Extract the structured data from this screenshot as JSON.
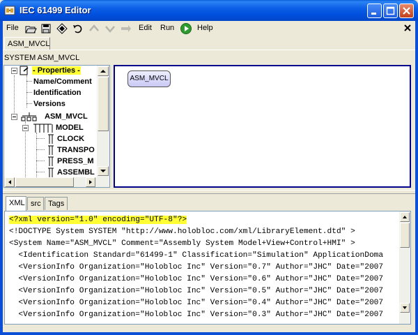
{
  "window": {
    "title": "IEC 61499 Editor"
  },
  "menu": {
    "file": "File",
    "edit": "Edit",
    "run": "Run",
    "help": "Help"
  },
  "toolbar": {
    "icons": [
      "open-folder-icon",
      "save-icon",
      "save-all-icon",
      "undo-icon",
      "up-arrow-icon",
      "down-arrow-icon",
      "right-arrow-icon",
      "run-icon"
    ]
  },
  "doc_tab": "ASM_MVCL",
  "system_label": "SYSTEM ASM_MVCL",
  "tree": {
    "properties": "- Properties -",
    "name_comment": "Name/Comment",
    "identification": "Identification",
    "versions": "Versions",
    "system": "ASM_MVCL",
    "model": "MODEL",
    "clock": "CLOCK",
    "transport": "TRANSPO",
    "press": "PRESS_M",
    "assembly": "ASSEMBL"
  },
  "diagram": {
    "block_label": "ASM_MVCL"
  },
  "bottom_tabs": [
    "XML",
    "src",
    "Tags"
  ],
  "xml": {
    "lines": [
      "<?xml version=\"1.0\" encoding=\"UTF-8\"?>",
      "<!DOCTYPE System SYSTEM \"http://www.holobloc.com/xml/LibraryElement.dtd\" >",
      "<System Name=\"ASM_MVCL\" Comment=\"Assembly System Model+View+Control+HMI\" >",
      "  <Identification Standard=\"61499-1\" Classification=\"Simulation\" ApplicationDoma",
      "  <VersionInfo Organization=\"Holobloc Inc\" Version=\"0.7\" Author=\"JHC\" Date=\"2007",
      "  <VersionInfo Organization=\"Holobloc Inc\" Version=\"0.6\" Author=\"JHC\" Date=\"2007",
      "  <VersionInfo Organization=\"Holobloc Inc\" Version=\"0.5\" Author=\"JHC\" Date=\"2007",
      "  <VersionInfo Organization=\"Holobloc Inc\" Version=\"0.4\" Author=\"JHC\" Date=\"2007",
      "  <VersionInfo Organization=\"Holobloc Inc\" Version=\"0.3\" Author=\"JHC\" Date=\"2007"
    ]
  },
  "colors": {
    "titlebar": "#0050de",
    "highlight": "#ffff33",
    "diagram_border": "#00008b",
    "run_green": "#2e9b2e"
  }
}
